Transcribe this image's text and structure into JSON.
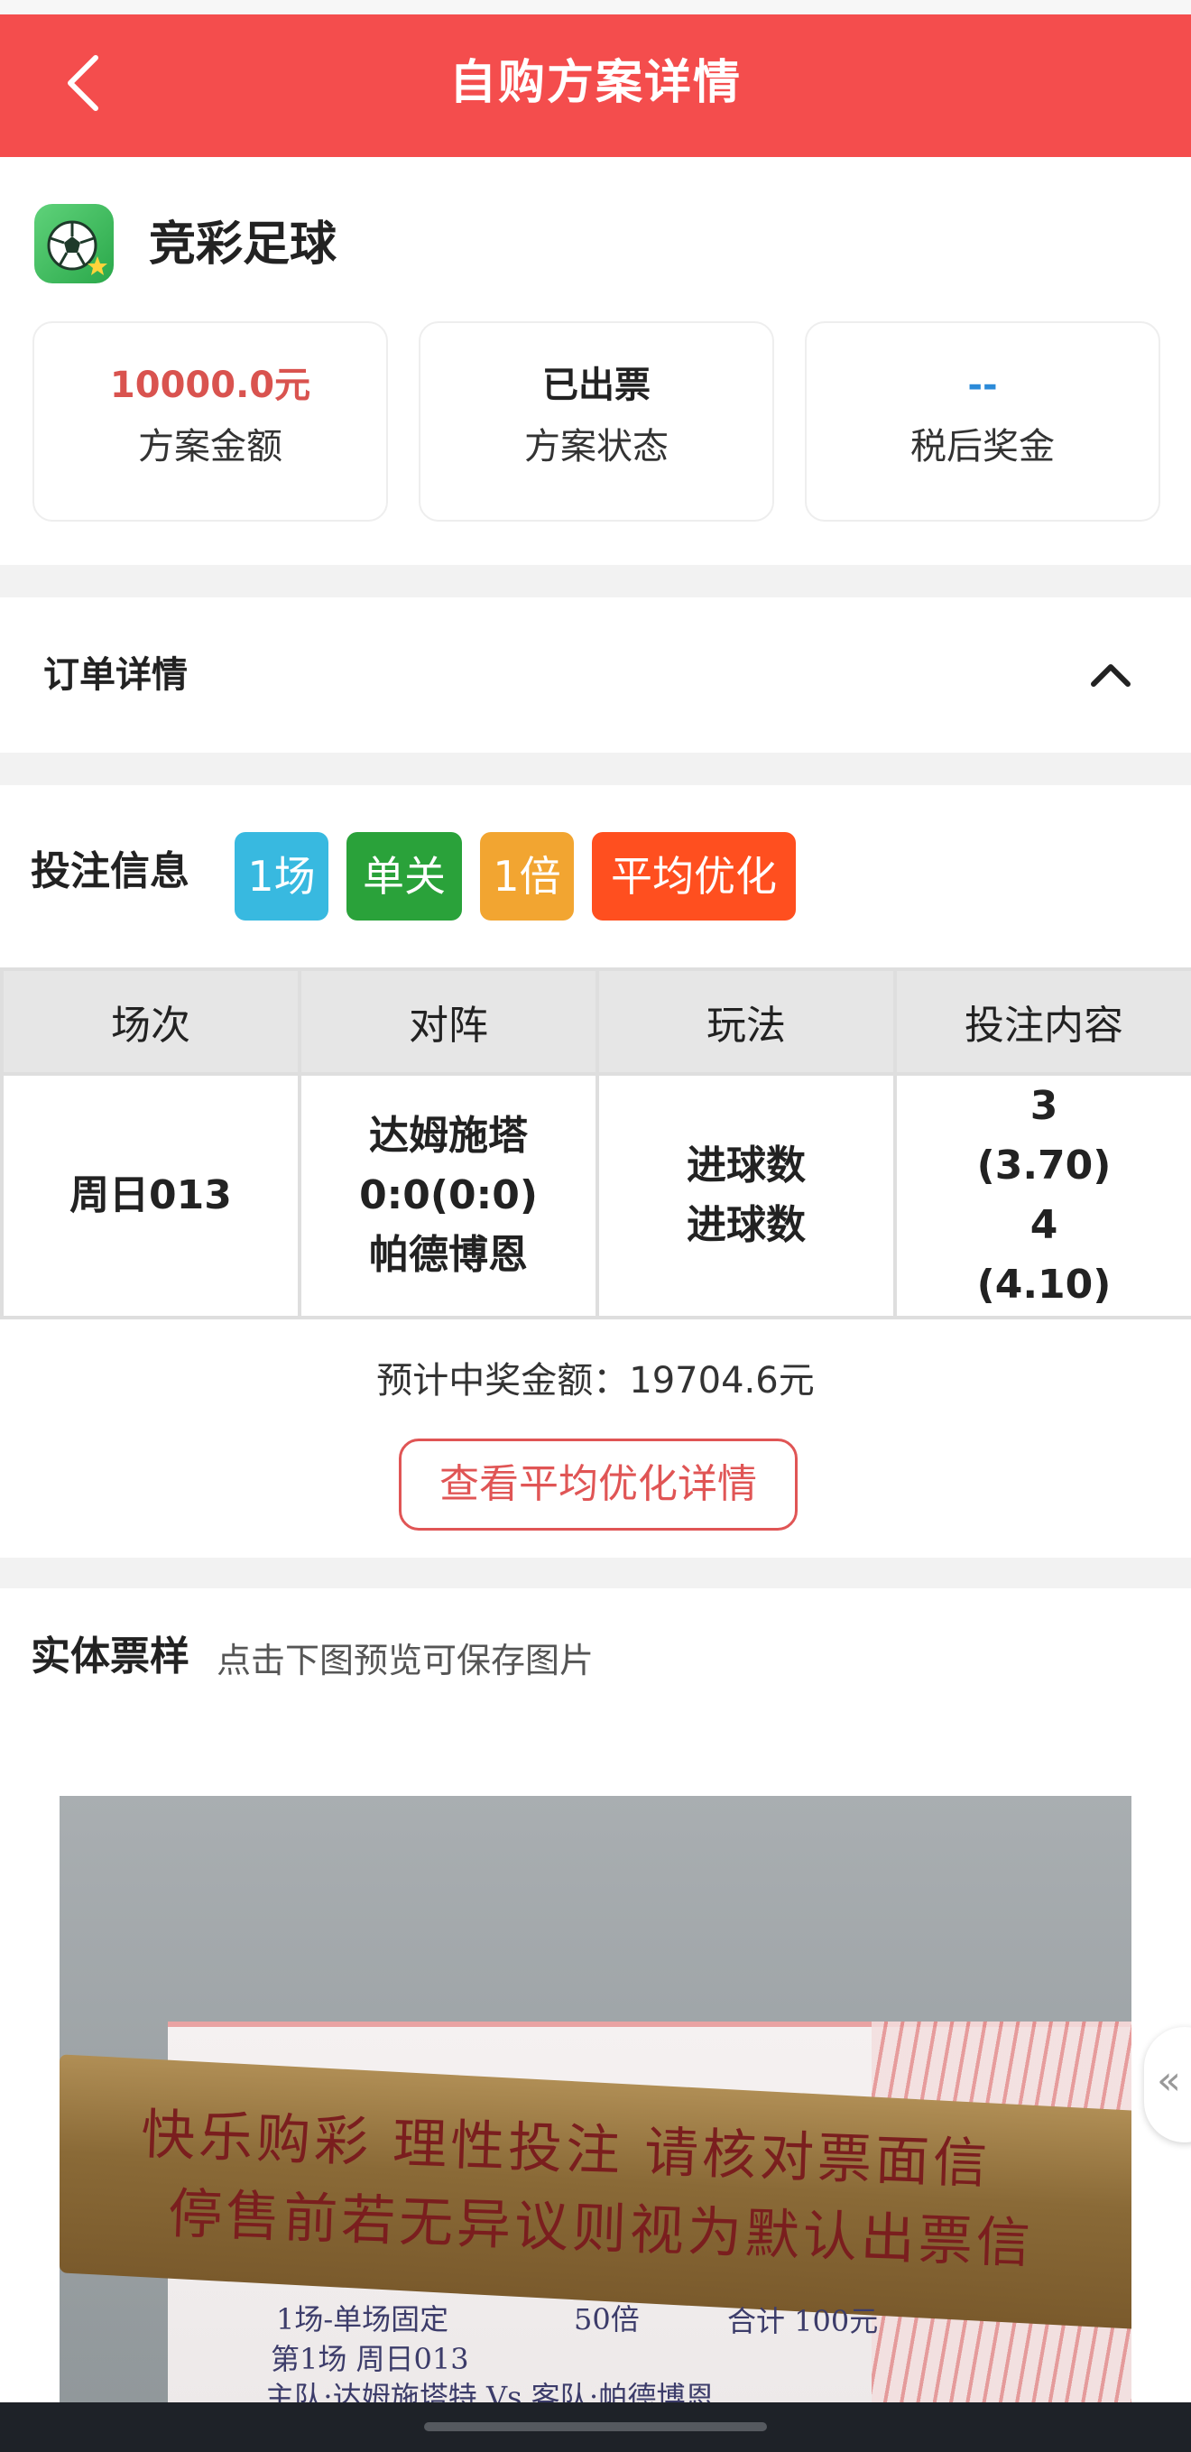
{
  "header": {
    "title": "自购方案详情"
  },
  "product": {
    "name": "竞彩足球"
  },
  "stats": [
    {
      "value": "10000.0元",
      "label": "方案金额",
      "color": "#d9534f"
    },
    {
      "value": "已出票",
      "label": "方案状态",
      "color": "#222222"
    },
    {
      "value": "--",
      "label": "税后奖金",
      "color": "#2b8ad8"
    }
  ],
  "order": {
    "label": "订单详情"
  },
  "bet": {
    "label": "投注信息",
    "tags": [
      {
        "text": "1场",
        "color": "#38b9e0"
      },
      {
        "text": "单关",
        "color": "#2aa23a"
      },
      {
        "text": "1倍",
        "color": "#f2a531"
      },
      {
        "text": "平均优化",
        "color": "#ff4f1f"
      }
    ],
    "table": {
      "headers": [
        "场次",
        "对阵",
        "玩法",
        "投注内容"
      ],
      "row": {
        "match_no": "周日013",
        "home": "达姆施塔",
        "score": "0:0(0:0)",
        "away": "帕德博恩",
        "play1": "进球数",
        "play2": "进球数",
        "pick1": "3",
        "odds1": "(3.70)",
        "pick2": "4",
        "odds2": "(4.10)"
      }
    },
    "estimate": "预计中奖金额：19704.6元",
    "optimize_button": "查看平均优化详情"
  },
  "photo": {
    "title": "实体票样",
    "subtitle": "点击下图预览可保存图片",
    "bar_line1": "快乐购彩  理性投注  请核对票面信",
    "bar_line2": "停售前若无异议则视为默认出票信",
    "ticket_line1_a": "1场-单场固定",
    "ticket_line1_b": "50倍",
    "ticket_line1_c": "合计 100元",
    "ticket_line2": "第1场  周日013",
    "ticket_line3": "主队:达姆施塔特 Vs  客队:帕德博恩"
  },
  "side_button": "«"
}
